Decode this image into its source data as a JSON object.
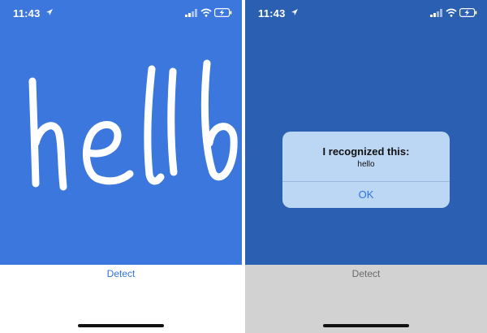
{
  "left_screen": {
    "status": {
      "time": "11:43"
    },
    "detect_label": "Detect"
  },
  "right_screen": {
    "status": {
      "time": "11:43"
    },
    "detect_label": "Detect",
    "alert": {
      "title": "I recognized this:",
      "message": "hello",
      "ok_label": "OK"
    }
  },
  "colors": {
    "canvas_blue": "#3b77dc",
    "canvas_dimmed": "#2a5fb2",
    "alert_bg": "#bcd7f4",
    "accent": "#2e74d8"
  },
  "icons": [
    "location-arrow-icon",
    "cellular-signal-icon",
    "wifi-icon",
    "battery-charging-icon"
  ]
}
